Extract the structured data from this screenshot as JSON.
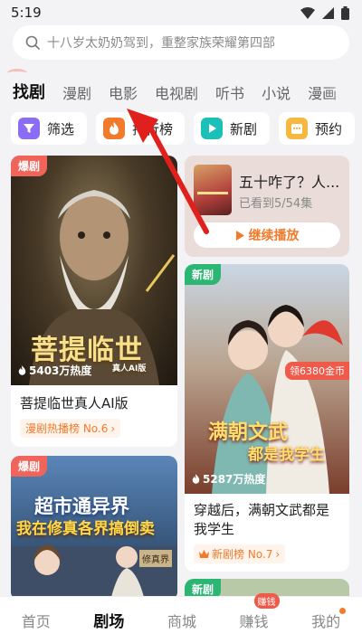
{
  "status": {
    "time": "5:19"
  },
  "search": {
    "placeholder": "十八岁太奶奶驾到，重整家族荣耀第四部"
  },
  "tabs": [
    {
      "label": "找剧",
      "active": true
    },
    {
      "label": "漫剧"
    },
    {
      "label": "电影"
    },
    {
      "label": "电视剧"
    },
    {
      "label": "听书"
    },
    {
      "label": "小说"
    },
    {
      "label": "漫画"
    }
  ],
  "chips": [
    {
      "label": "筛选",
      "icon": "filter-icon",
      "color": "#8b6cf5"
    },
    {
      "label": "排行榜",
      "icon": "flame-icon",
      "color": "#f27a2b"
    },
    {
      "label": "新剧",
      "icon": "play-icon",
      "color": "#1bc0b8"
    },
    {
      "label": "预约",
      "icon": "calendar-icon",
      "color": "#f5b942"
    }
  ],
  "cards": {
    "left1": {
      "tag": "爆剧",
      "poster_text": "菩提临世",
      "poster_sub": "真人AI版",
      "heat": "5403万热度",
      "title": "菩提临世真人AI版",
      "rank": "漫剧热播榜 No.6"
    },
    "continue": {
      "title": "五十咋了？人...",
      "progress": "已看到5/54集",
      "button": "继续播放"
    },
    "right1": {
      "tag": "新剧",
      "coin": "领6380金币",
      "poster_text_1": "满朝文武",
      "poster_text_2": "都是我学生",
      "heat": "5287万热度",
      "title": "穿越后，满朝文武都是我学生",
      "rank": "新剧榜 No.7"
    },
    "left2": {
      "tag": "爆剧",
      "poster_text_1": "超市通异界",
      "poster_text_2": "我在修真各界搞倒卖",
      "sign": "修真界"
    },
    "right2": {
      "tag": "新剧"
    }
  },
  "nav": {
    "items": [
      {
        "label": "首页"
      },
      {
        "label": "剧场",
        "active": true
      },
      {
        "label": "商城"
      },
      {
        "label": "赚钱",
        "badge": "赚钱"
      },
      {
        "label": "我的",
        "dot": true
      }
    ]
  },
  "colors": {
    "accent": "#f27a2b",
    "tag_red": "#f0645a",
    "tag_green": "#2bb673",
    "arrow": "#e0201c"
  }
}
